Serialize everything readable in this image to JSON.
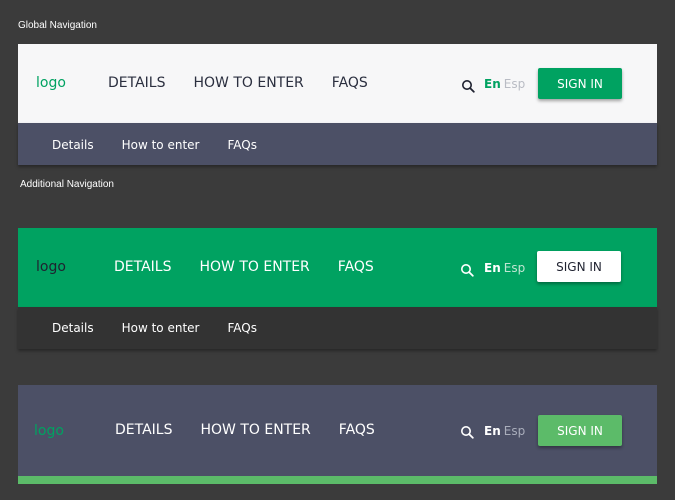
{
  "colors": {
    "background": "#3b3b3b",
    "green": "#00a261",
    "light_green": "#5cbb69",
    "slate": "#4c5066",
    "dark": "#333333",
    "white": "#ffffff"
  },
  "captions": {
    "global": "Global Navigation",
    "additional": "Additional Navigation"
  },
  "navbars": [
    {
      "logo": "logo",
      "links": [
        "DETAILS",
        "HOW TO ENTER",
        "FAQS"
      ],
      "lang_active": "En",
      "lang_other": "Esp",
      "signin": "SIGN IN",
      "search_icon": "search-icon",
      "sub_links": [
        "Details",
        "How to enter",
        "FAQs"
      ]
    },
    {
      "logo": "logo",
      "links": [
        "DETAILS",
        "HOW TO ENTER",
        "FAQS"
      ],
      "lang_active": "En",
      "lang_other": "Esp",
      "signin": "SIGN IN",
      "search_icon": "search-icon",
      "sub_links": [
        "Details",
        "How to enter",
        "FAQs"
      ]
    },
    {
      "logo": "logo",
      "links": [
        "DETAILS",
        "HOW TO ENTER",
        "FAQS"
      ],
      "lang_active": "En",
      "lang_other": "Esp",
      "signin": "SIGN IN",
      "search_icon": "search-icon"
    }
  ]
}
